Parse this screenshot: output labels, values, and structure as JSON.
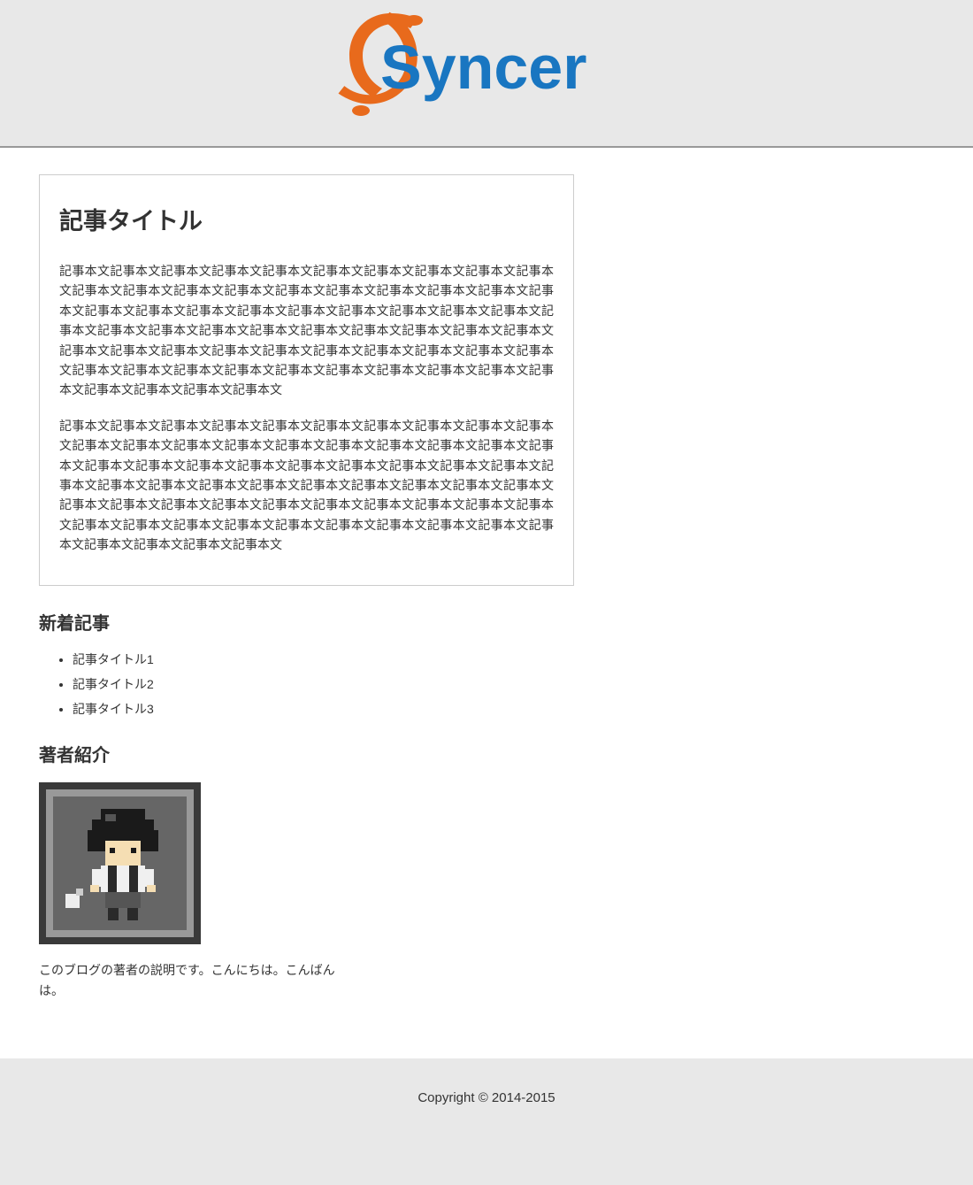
{
  "header": {
    "logo_text": "Syncer"
  },
  "article": {
    "title": "記事タイトル",
    "paragraphs": [
      "記事本文記事本文記事本文記事本文記事本文記事本文記事本文記事本文記事本文記事本文記事本文記事本文記事本文記事本文記事本文記事本文記事本文記事本文記事本文記事本文記事本文記事本文記事本文記事本文記事本文記事本文記事本文記事本文記事本文記事本文記事本文記事本文記事本文記事本文記事本文記事本文記事本文記事本文記事本文記事本文記事本文記事本文記事本文記事本文記事本文記事本文記事本文記事本文記事本文記事本文記事本文記事本文記事本文記事本文記事本文記事本文記事本文記事本文記事本文記事本文記事本文記事本文記事本文",
      "記事本文記事本文記事本文記事本文記事本文記事本文記事本文記事本文記事本文記事本文記事本文記事本文記事本文記事本文記事本文記事本文記事本文記事本文記事本文記事本文記事本文記事本文記事本文記事本文記事本文記事本文記事本文記事本文記事本文記事本文記事本文記事本文記事本文記事本文記事本文記事本文記事本文記事本文記事本文記事本文記事本文記事本文記事本文記事本文記事本文記事本文記事本文記事本文記事本文記事本文記事本文記事本文記事本文記事本文記事本文記事本文記事本文記事本文記事本文記事本文記事本文記事本文記事本文"
    ]
  },
  "recent": {
    "heading": "新着記事",
    "items": [
      "記事タイトル1",
      "記事タイトル2",
      "記事タイトル3"
    ]
  },
  "author": {
    "heading": "著者紹介",
    "description": "このブログの著者の説明です。こんにちは。こんばんは。"
  },
  "footer": {
    "copyright": "Copyright © 2014-2015"
  }
}
